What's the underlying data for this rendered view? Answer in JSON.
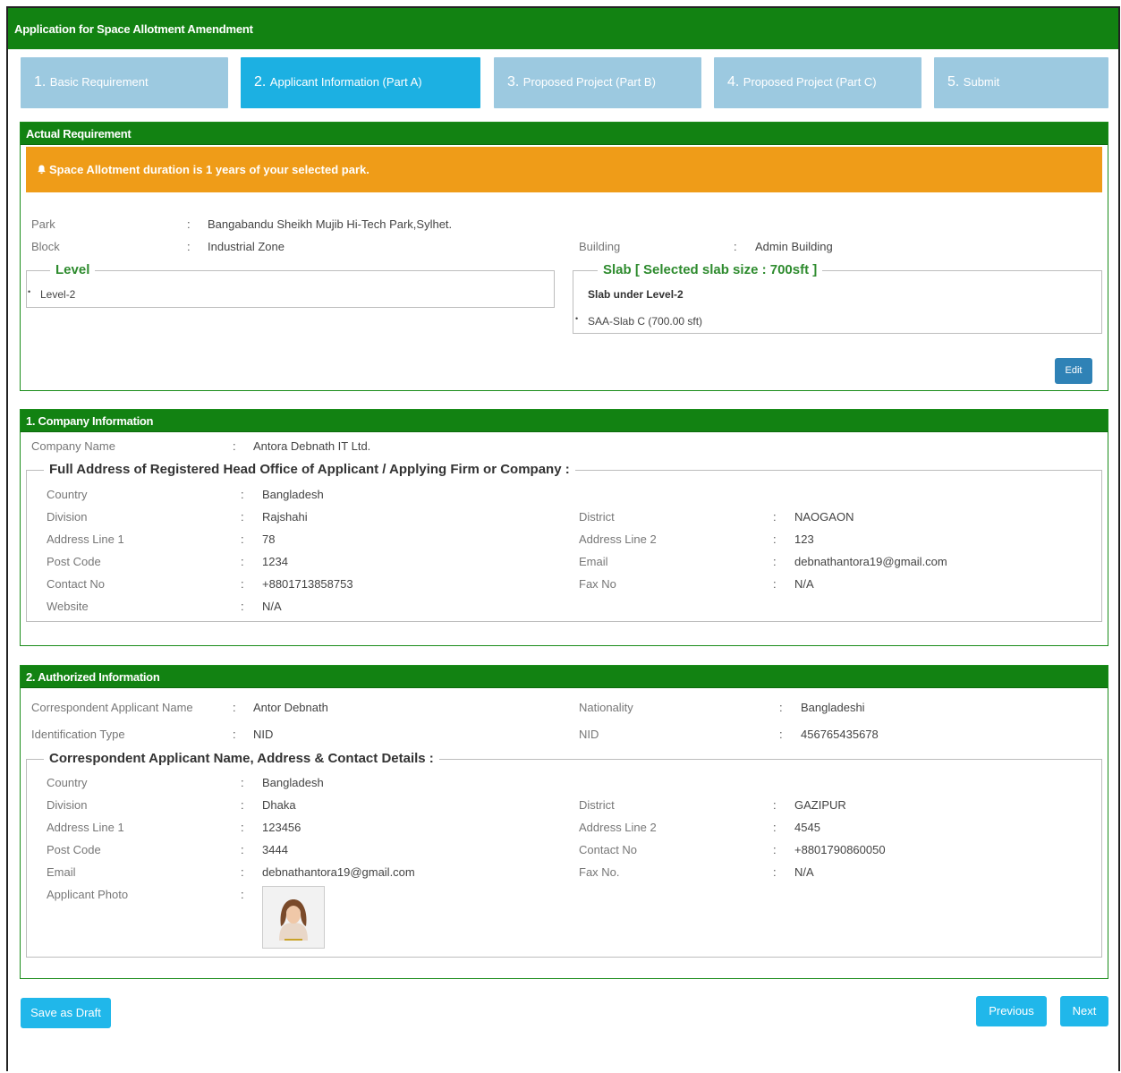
{
  "window": {
    "title": "Application for Space Allotment Amendment"
  },
  "steps": [
    {
      "num": "1.",
      "label": "Basic Requirement",
      "active": false
    },
    {
      "num": "2.",
      "label": "Applicant Information (Part A)",
      "active": true
    },
    {
      "num": "3.",
      "label": "Proposed Project (Part B)",
      "active": false
    },
    {
      "num": "4.",
      "label": "Proposed Project (Part C)",
      "active": false
    },
    {
      "num": "5.",
      "label": "Submit",
      "active": false
    }
  ],
  "actual": {
    "heading": "Actual Requirement",
    "alert": "Space Allotment duration is 1 years of your selected park.",
    "park_label": "Park",
    "park": "Bangabandu Sheikh Mujib Hi-Tech Park,Sylhet.",
    "block_label": "Block",
    "block": "Industrial Zone",
    "building_label": "Building",
    "building": "Admin Building",
    "level_legend": "Level",
    "level_item": "Level-2",
    "slab_legend": "Slab [ Selected slab size : 700sft ]",
    "slab_heading": "Slab under Level-2",
    "slab_item": "SAA-Slab C (700.00 sft)",
    "edit": "Edit"
  },
  "company": {
    "heading": "1. Company Information",
    "name_label": "Company Name",
    "name": "Antora Debnath IT Ltd.",
    "legend": "Full Address of Registered Head Office of Applicant / Applying Firm or Company :",
    "country_label": "Country",
    "country": "Bangladesh",
    "division_label": "Division",
    "division": "Rajshahi",
    "district_label": "District",
    "district": "NAOGAON",
    "addr1_label": "Address Line 1",
    "addr1": "78",
    "addr2_label": "Address Line 2",
    "addr2": "123",
    "post_label": "Post Code",
    "post": "1234",
    "email_label": "Email",
    "email": "debnathantora19@gmail.com",
    "contact_label": "Contact No",
    "contact": "+8801713858753",
    "fax_label": "Fax No",
    "fax": "N/A",
    "website_label": "Website",
    "website": "N/A"
  },
  "authorized": {
    "heading": "2. Authorized Information",
    "name_label": "Correspondent Applicant Name",
    "name": "Antor Debnath",
    "nationality_label": "Nationality",
    "nationality": "Bangladeshi",
    "idtype_label": "Identification Type",
    "idtype": "NID",
    "nid_label": "NID",
    "nid": "456765435678",
    "legend": "Correspondent Applicant Name, Address & Contact Details :",
    "country_label": "Country",
    "country": "Bangladesh",
    "division_label": "Division",
    "division": "Dhaka",
    "district_label": "District",
    "district": "GAZIPUR",
    "addr1_label": "Address Line 1",
    "addr1": "123456",
    "addr2_label": "Address Line 2",
    "addr2": "4545",
    "post_label": "Post Code",
    "post": "3444",
    "contact_label": "Contact No",
    "contact": "+8801790860050",
    "email_label": "Email",
    "email": "debnathantora19@gmail.com",
    "fax_label": "Fax No.",
    "fax": "N/A",
    "photo_label": "Applicant Photo"
  },
  "footer": {
    "draft": "Save as Draft",
    "previous": "Previous",
    "next": "Next"
  },
  "colon": ":",
  "colors": {
    "header_green": "#128212",
    "step_active": "#1cb0e2",
    "step_inactive": "#9cc9e0",
    "alert": "#ef9c18",
    "button": "#20b7ea"
  },
  "icons": {
    "alert": "bell-icon"
  }
}
